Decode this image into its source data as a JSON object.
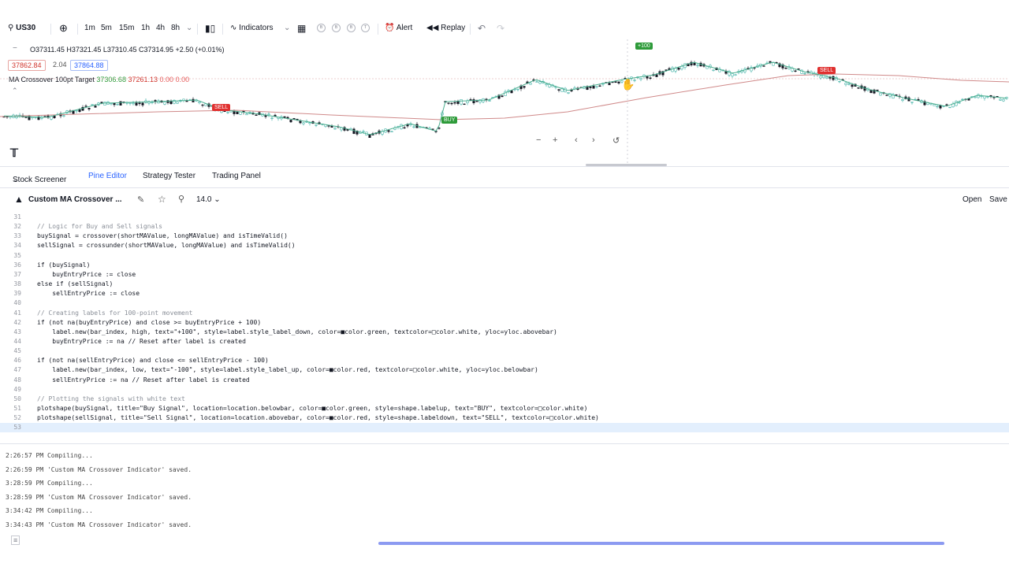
{
  "toolbar": {
    "symbol": "US30",
    "intervals": [
      "1m",
      "5m",
      "15m",
      "1h",
      "4h",
      "8h"
    ],
    "indicators_label": "Indicators",
    "template_badges": [
      "B",
      "B",
      "B",
      "T"
    ],
    "alert_label": "Alert",
    "replay_label": "Replay"
  },
  "chart": {
    "ohlc": "O37311.45 H37321.45 L37310.45 C37314.95 +2.50 (+0.01%)",
    "bid": "37862.84",
    "spread": "2.04",
    "ask": "37864.88",
    "indicator_name": "MA Crossover 100pt Target",
    "indicator_v1": "37306.68",
    "indicator_v2": "37261.13",
    "indicator_v3": "0.00",
    "indicator_v4": "0.00",
    "signals": {
      "sell1": "SELL",
      "buy": "BUY",
      "plus100": "+100",
      "sell2": "SELL"
    },
    "colors": {
      "up": "#26a69a",
      "down": "#131722",
      "short_ma": "#4caf90",
      "long_ma": "#d08a8a",
      "buy": "#2e9b3a",
      "sell": "#e0302f"
    }
  },
  "bottom_tabs": [
    "Stock Screener",
    "Pine Editor",
    "Strategy Tester",
    "Trading Panel"
  ],
  "editor": {
    "script_name": "Custom MA Crossover ...",
    "version": "14.0",
    "open_label": "Open",
    "save_label": "Save"
  },
  "code_lines": [
    {
      "n": "31",
      "t": ""
    },
    {
      "n": "32",
      "t": "// Logic for Buy and Sell signals"
    },
    {
      "n": "33",
      "t": "buySignal = crossover(shortMAValue, longMAValue) and isTimeValid()"
    },
    {
      "n": "34",
      "t": "sellSignal = crossunder(shortMAValue, longMAValue) and isTimeValid()"
    },
    {
      "n": "35",
      "t": ""
    },
    {
      "n": "36",
      "t": "if (buySignal)"
    },
    {
      "n": "37",
      "t": "    buyEntryPrice := close"
    },
    {
      "n": "38",
      "t": "else if (sellSignal)"
    },
    {
      "n": "39",
      "t": "    sellEntryPrice := close"
    },
    {
      "n": "40",
      "t": ""
    },
    {
      "n": "41",
      "t": "// Creating labels for 100-point movement"
    },
    {
      "n": "42",
      "t": "if (not na(buyEntryPrice) and close >= buyEntryPrice + 100)"
    },
    {
      "n": "43",
      "t": "    label.new(bar_index, high, text=\"+100\", style=label.style_label_down, color=■color.green, textcolor=□color.white, yloc=yloc.abovebar)"
    },
    {
      "n": "44",
      "t": "    buyEntryPrice := na // Reset after label is created"
    },
    {
      "n": "45",
      "t": ""
    },
    {
      "n": "46",
      "t": "if (not na(sellEntryPrice) and close <= sellEntryPrice - 100)"
    },
    {
      "n": "47",
      "t": "    label.new(bar_index, low, text=\"-100\", style=label.style_label_up, color=■color.red, textcolor=□color.white, yloc=yloc.belowbar)"
    },
    {
      "n": "48",
      "t": "    sellEntryPrice := na // Reset after label is created"
    },
    {
      "n": "49",
      "t": ""
    },
    {
      "n": "50",
      "t": "// Plotting the signals with white text"
    },
    {
      "n": "51",
      "t": "plotshape(buySignal, title=\"Buy Signal\", location=location.belowbar, color=■color.green, style=shape.labelup, text=\"BUY\", textcolor=□color.white)"
    },
    {
      "n": "52",
      "t": "plotshape(sellSignal, title=\"Sell Signal\", location=location.abovebar, color=■color.red, style=shape.labeldown, text=\"SELL\", textcolor=□color.white)"
    },
    {
      "n": "53",
      "t": ""
    }
  ],
  "console_lines": [
    "2:26:57 PM Compiling...",
    "2:26:59 PM 'Custom MA Crossover Indicator' saved.",
    "3:28:59 PM Compiling...",
    "3:28:59 PM 'Custom MA Crossover Indicator' saved.",
    "3:34:42 PM Compiling...",
    "3:34:43 PM 'Custom MA Crossover Indicator' saved."
  ]
}
